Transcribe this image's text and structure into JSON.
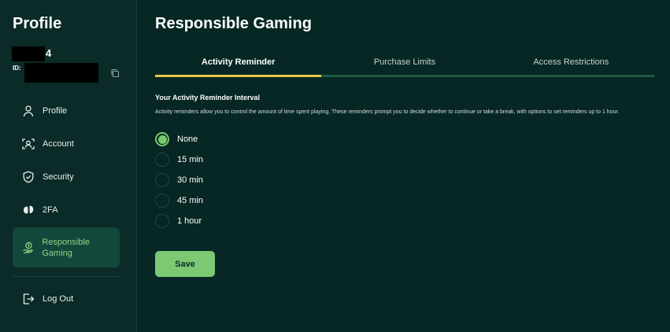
{
  "sidebar": {
    "title": "Profile",
    "user_suffix": "4",
    "id_label": "ID:",
    "items": [
      {
        "label": "Profile"
      },
      {
        "label": "Account"
      },
      {
        "label": "Security"
      },
      {
        "label": "2FA"
      },
      {
        "label": "Responsible Gaming"
      },
      {
        "label": "Log Out"
      }
    ]
  },
  "main": {
    "title": "Responsible Gaming",
    "tabs": [
      {
        "label": "Activity Reminder"
      },
      {
        "label": "Purchase Limits"
      },
      {
        "label": "Access Restrictions"
      }
    ],
    "section_title": "Your Activity Reminder Interval",
    "section_desc": "Activity reminders allow you to control the amount of time spent playing. These reminders prompt you to decide whether to continue or take a break, with options to set reminders up to 1 hour.",
    "options": [
      {
        "label": "None"
      },
      {
        "label": "15 min"
      },
      {
        "label": "30 min"
      },
      {
        "label": "45 min"
      },
      {
        "label": "1 hour"
      }
    ],
    "selected_option": "None",
    "save_label": "Save"
  },
  "colors": {
    "background": "#062723",
    "sidebar": "#0a2b27",
    "accent_green": "#7cc873",
    "tab_active": "#e6c649",
    "nav_active_bg": "#14473b"
  },
  "icons": [
    "copy-icon",
    "user-icon",
    "account-icon",
    "shield-icon",
    "2fa-icon",
    "money-hand-icon",
    "logout-icon"
  ]
}
